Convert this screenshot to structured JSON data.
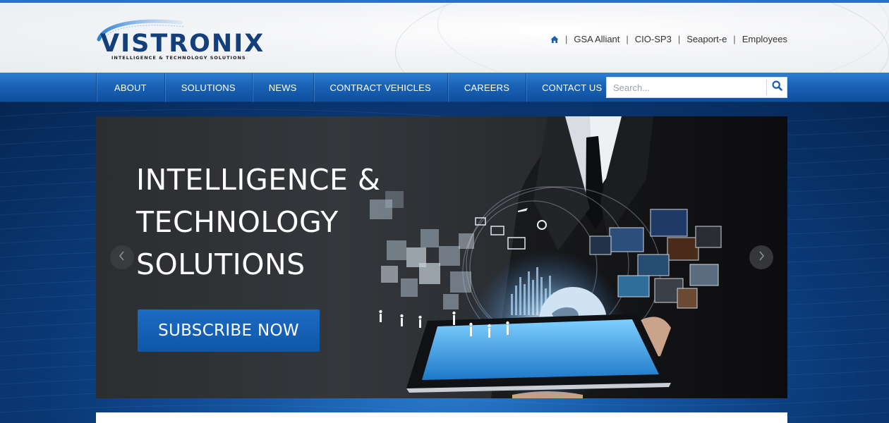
{
  "brand": {
    "name": "VISTRONIX",
    "tagline": "INTELLIGENCE & TECHNOLOGY SOLUTIONS",
    "primary_color": "#13407a",
    "accent_color": "#1a63b6"
  },
  "utility_nav": {
    "home_icon": "home-icon",
    "links": [
      "GSA Alliant",
      "CIO-SP3",
      "Seaport-e",
      "Employees"
    ],
    "separator": "|"
  },
  "main_nav": {
    "items": [
      "ABOUT",
      "SOLUTIONS",
      "NEWS",
      "CONTRACT VEHICLES",
      "CAREERS",
      "CONTACT US"
    ]
  },
  "search": {
    "placeholder": "Search...",
    "value": "",
    "icon": "search-icon"
  },
  "hero": {
    "title_lines": [
      "INTELLIGENCE &",
      "TECHNOLOGY",
      "SOLUTIONS"
    ],
    "cta_label": "SUBSCRIBE NOW",
    "prev_icon": "chevron-left-icon",
    "next_icon": "chevron-right-icon"
  }
}
